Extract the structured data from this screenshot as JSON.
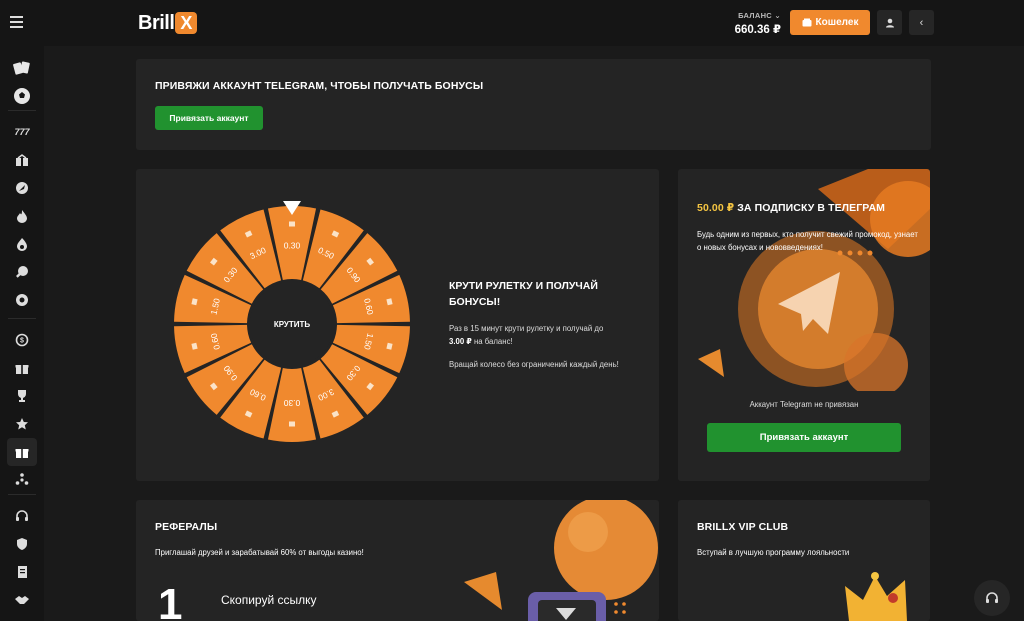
{
  "header": {
    "logo_text": "Brill",
    "logo_x": "X",
    "balance_label": "БАЛАНС",
    "balance_value": "660.36 ₽",
    "wallet_label": "Кошелек"
  },
  "telegram_banner": {
    "title": "ПРИВЯЖИ АККАУНТ TELEGRAM, ЧТОБЫ ПОЛУЧАТЬ БОНУСЫ",
    "button": "Привязать аккаунт"
  },
  "wheel": {
    "spin_label": "КРУТИТЬ",
    "segments": [
      "0.30",
      "0.50",
      "0.90",
      "0.60",
      "1.50",
      "0.30",
      "3.00",
      "0.30",
      "0.60",
      "0.90",
      "0.60",
      "1.50",
      "0.30",
      "3.00"
    ],
    "title": "КРУТИ РУЛЕТКУ И ПОЛУЧАЙ БОНУСЫ!",
    "desc_line1": "Раз в 15 минут крути рулетку и получай до",
    "desc_amount": "3.00 ₽",
    "desc_line2": "на баланс!",
    "desc2": "Вращай колесо без ограничений каждый день!"
  },
  "subscribe": {
    "amount": "50.00 ₽",
    "title_rest": "ЗА ПОДПИСКУ В ТЕЛЕГРАМ",
    "desc": "Будь одним из первых, кто получит свежий промокод, узнает о новых бонусах и нововведениях!",
    "status": "Аккаунт Telegram не привязан",
    "button": "Привязать аккаунт"
  },
  "referrals": {
    "title": "РЕФЕРАЛЫ",
    "desc": "Приглашай друзей и зарабатывай 60% от выгоды казино!",
    "step_number": "1",
    "step_label": "Скопируй ссылку"
  },
  "vip": {
    "title": "BRILLX VIP CLUB",
    "desc": "Вступай в лучшую программу лояльности"
  },
  "sidebar_icons": [
    "cards-icon",
    "soccer-ball-icon",
    "777-icon",
    "gift-box-icon",
    "rocket-icon",
    "fire-icon",
    "flame-icon",
    "ping-pong-icon",
    "poker-chip-icon",
    "coin-icon",
    "gift-icon",
    "trophy-icon",
    "star-icon",
    "present-icon",
    "spinner-icon",
    "headset-icon",
    "shield-icon",
    "receipt-icon",
    "handshake-icon"
  ],
  "colors": {
    "accent": "#f0892e",
    "green": "#21922f",
    "card": "#242424",
    "bg": "#1a1a1a",
    "gold": "#f5c542"
  }
}
